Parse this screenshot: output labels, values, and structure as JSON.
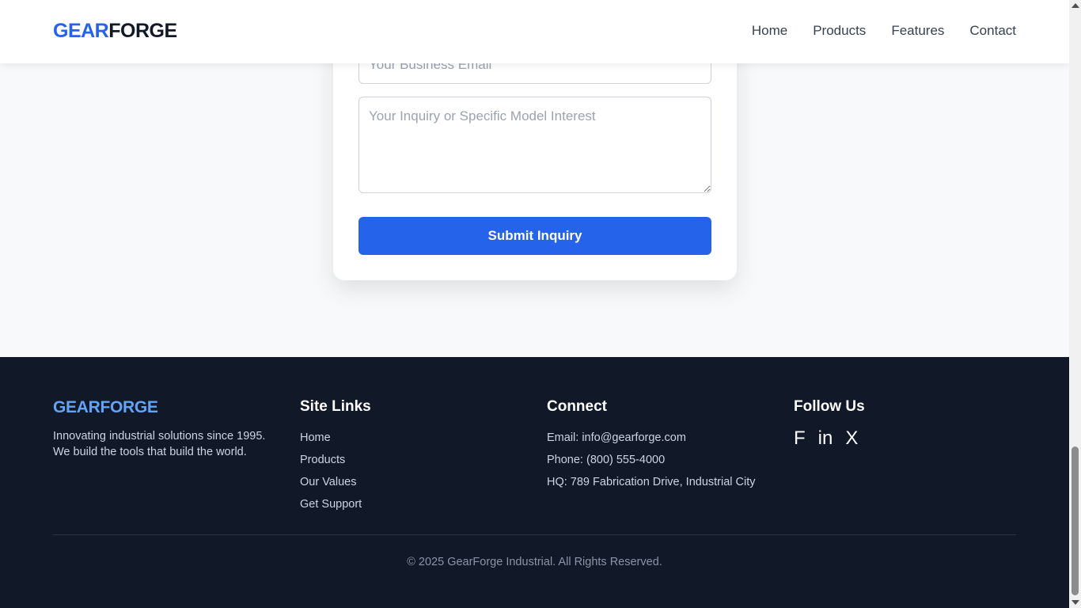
{
  "header": {
    "logo_part1": "GEAR",
    "logo_part2": "FORGE",
    "nav": [
      "Home",
      "Products",
      "Features",
      "Contact"
    ]
  },
  "form": {
    "email_placeholder": "Your Business Email",
    "email_value": "",
    "message_placeholder": "Your Inquiry or Specific Model Interest",
    "message_value": "",
    "submit_label": "Submit Inquiry"
  },
  "footer": {
    "brand": {
      "name": "GEARFORGE",
      "tagline": "Innovating industrial solutions since 1995. We build the tools that build the world."
    },
    "site_links": {
      "heading": "Site Links",
      "items": [
        "Home",
        "Products",
        "Our Values",
        "Get Support"
      ]
    },
    "connect": {
      "heading": "Connect",
      "items": [
        "Email: info@gearforge.com",
        "Phone: (800) 555-4000",
        "HQ: 789 Fabrication Drive, Industrial City"
      ]
    },
    "follow": {
      "heading": "Follow Us",
      "icons": [
        {
          "name": "facebook-icon",
          "glyph": "F"
        },
        {
          "name": "linkedin-icon",
          "glyph": "in"
        },
        {
          "name": "x-twitter-icon",
          "glyph": "X"
        }
      ]
    },
    "copyright": "© 2025 GearForge Industrial. All Rights Reserved."
  },
  "colors": {
    "accent": "#2563eb",
    "footer_bg": "#111827",
    "footer_brand": "#60a5fa",
    "page_bg": "#f8f9fb"
  }
}
